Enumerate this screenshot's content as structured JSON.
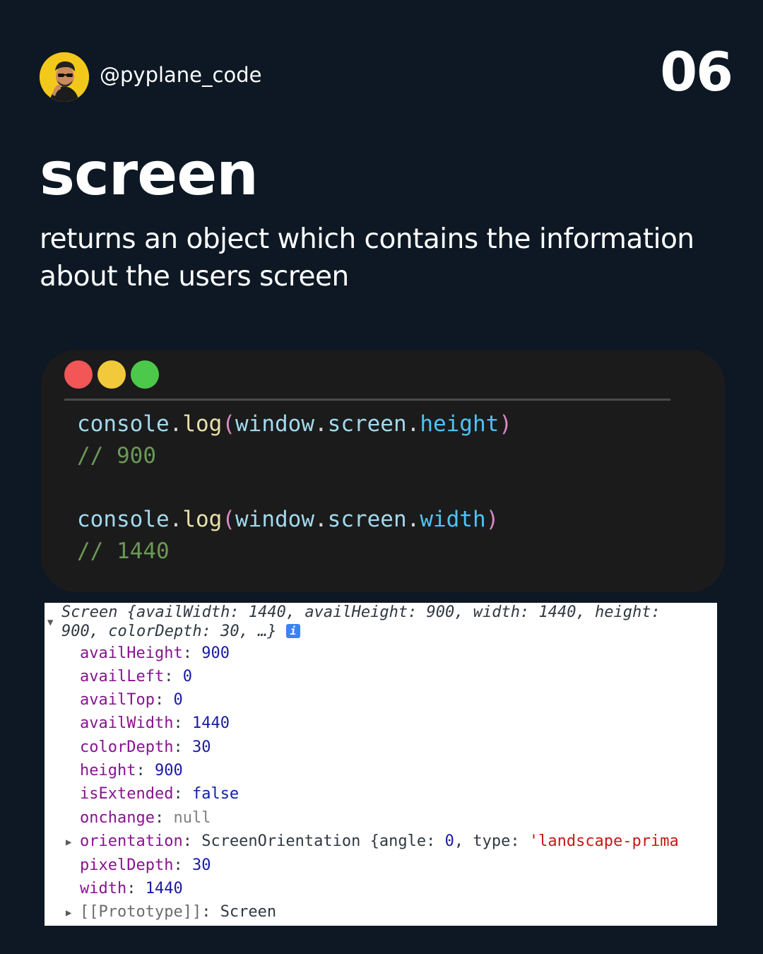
{
  "header": {
    "handle": "@pyplane_code",
    "page_number": "06"
  },
  "title": "screen",
  "description": "returns an object which contains the information about the users screen",
  "code_window": {
    "dots": [
      "red",
      "yellow",
      "green"
    ],
    "blocks": [
      {
        "object": "console",
        "method": "log",
        "arg_obj": "window",
        "arg_mid": "screen",
        "arg_prop": "height",
        "comment": "// 900"
      },
      {
        "object": "console",
        "method": "log",
        "arg_obj": "window",
        "arg_mid": "screen",
        "arg_prop": "width",
        "comment": "// 1440"
      }
    ]
  },
  "console_output": {
    "summary_line1": "Screen {availWidth: 1440, availHeight: 900, width: 1440, height:",
    "summary_line2": "900, colorDepth: 30, …}",
    "info_icon": "i",
    "properties": [
      {
        "key": "availHeight",
        "value": "900",
        "type": "number"
      },
      {
        "key": "availLeft",
        "value": "0",
        "type": "number"
      },
      {
        "key": "availTop",
        "value": "0",
        "type": "number"
      },
      {
        "key": "availWidth",
        "value": "1440",
        "type": "number"
      },
      {
        "key": "colorDepth",
        "value": "30",
        "type": "number"
      },
      {
        "key": "height",
        "value": "900",
        "type": "number"
      },
      {
        "key": "isExtended",
        "value": "false",
        "type": "keyword"
      },
      {
        "key": "onchange",
        "value": "null",
        "type": "null"
      }
    ],
    "orientation": {
      "key": "orientation",
      "class_name": "ScreenOrientation",
      "brace_open": "{",
      "angle_key": "angle",
      "angle_value": "0",
      "type_key": "type",
      "type_value": "'landscape-prima"
    },
    "properties_after": [
      {
        "key": "pixelDepth",
        "value": "30",
        "type": "number"
      },
      {
        "key": "width",
        "value": "1440",
        "type": "number"
      }
    ],
    "prototype": {
      "key": "[[Prototype]]",
      "value": "Screen"
    }
  },
  "colors": {
    "background": "#0d1824",
    "code_bg": "#1b1b1c",
    "dot_red": "#f25656",
    "dot_yellow": "#f2c93b",
    "dot_green": "#4cc94a"
  }
}
